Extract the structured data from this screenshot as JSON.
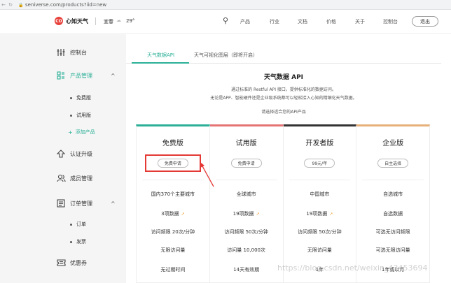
{
  "browser": {
    "url": "seniverse.com/products?iid=new"
  },
  "header": {
    "logo_mark": "CO",
    "logo_name": "心知天气",
    "city": "宜春",
    "temperature": "29°",
    "nav": [
      "产品",
      "行业",
      "文档",
      "价格",
      "关于",
      "控制台"
    ],
    "logout": "退出"
  },
  "sidebar": {
    "items": [
      {
        "label": "控制台",
        "icon": "sliders-icon"
      },
      {
        "label": "产品管理",
        "icon": "grid-icon"
      },
      {
        "label": "认证升级",
        "icon": "upload-icon"
      },
      {
        "label": "成员管理",
        "icon": "users-icon"
      },
      {
        "label": "订单管理",
        "icon": "list-icon"
      },
      {
        "label": "优惠券",
        "icon": "ticket-icon"
      }
    ],
    "product_sub": [
      "免费版",
      "试用版"
    ],
    "add_product": "添加产品",
    "order_sub": [
      "订单",
      "发票"
    ],
    "accent": "#2bb097"
  },
  "main": {
    "tabs": [
      "天气数据API",
      "天气可视化图层（即将开启）"
    ],
    "title": "天气数据 API",
    "desc_line1": "通过标准的 Restful API 接口，提供标准化的数据访问。",
    "desc_line2": "无论是APP、智能硬件还是企业级系统都可以轻松接入心知的精细化天气数据。",
    "choose": "请选择适合您的API产品",
    "plans": [
      {
        "name": "免费版",
        "button": "免费申请",
        "color": "#2bb097",
        "features": [
          "国内370个主要城市",
          "3项数据",
          "访问频限 20次/分钟",
          "无限访问量",
          "无过期时间"
        ]
      },
      {
        "name": "试用版",
        "button": "免费申请",
        "color": "#e57373",
        "features": [
          "全球城市",
          "19项数据",
          "访问频限 50次/分钟",
          "访问量 10,000次",
          "14天有效期"
        ]
      },
      {
        "name": "开发者版",
        "button": "99元/年",
        "color": "#333333",
        "features": [
          "中国城市",
          "19项数据",
          "访问频限 50次/分钟",
          "无限访问量",
          "1年"
        ]
      },
      {
        "name": "企业版",
        "button": "自主选择",
        "color": "#e6b07a",
        "features": [
          "自选城市",
          "自选数据",
          "可选无访问频限",
          "可选无限访问量",
          "1年或以月"
        ]
      }
    ]
  },
  "watermark": "https://blog.csdn.net/weixin_43453694"
}
